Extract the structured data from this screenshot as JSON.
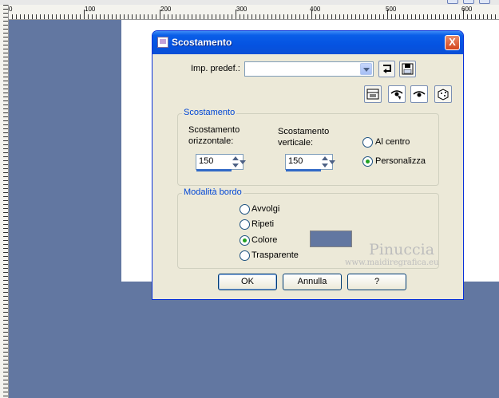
{
  "ruler": {
    "marks": [
      "0",
      "100",
      "200",
      "300",
      "400",
      "500",
      "600"
    ]
  },
  "dialog": {
    "title": "Scostamento",
    "close_label": "X",
    "preset_label": "Imp. predef.:",
    "preset_value": "",
    "offset_group": {
      "title": "Scostamento",
      "horizontal_label_line1": "Scostamento",
      "horizontal_label_line2": "orizzontale:",
      "horizontal_value": "150",
      "vertical_label_line1": "Scostamento",
      "vertical_label_line2": "verticale:",
      "vertical_value": "150",
      "center_label": "Al centro",
      "custom_label": "Personalizza",
      "selected": "Personalizza"
    },
    "edge_group": {
      "title": "Modalità bordo",
      "options": [
        "Avvolgi",
        "Ripeti",
        "Colore",
        "Trasparente"
      ],
      "selected": "Colore",
      "color": "#6277a1"
    },
    "buttons": {
      "ok": "OK",
      "cancel": "Annulla",
      "help": "?"
    }
  },
  "watermark": {
    "name": "Pinuccia",
    "url": "www.maidiregrafica.eu"
  },
  "colors": {
    "canvas": "#6277a1",
    "titlebar": "#0a5ee8",
    "dialog_bg": "#ece9d8",
    "group_title": "#0046d5"
  }
}
